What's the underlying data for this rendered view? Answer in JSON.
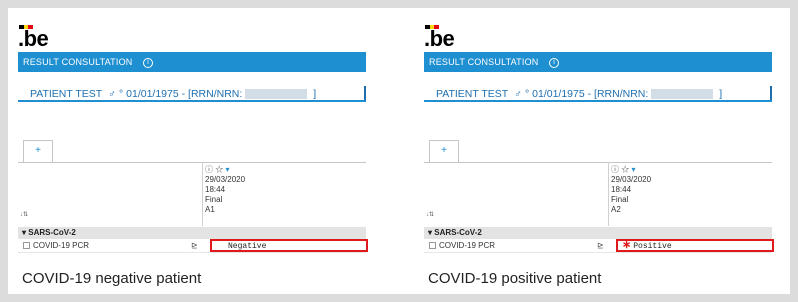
{
  "colors": {
    "header_blue": "#1e8fd0",
    "highlight_red": "#e0191c"
  },
  "panels": [
    {
      "logo": ".be",
      "header": "RESULT CONSULTATION",
      "header_icon": "info-icon",
      "patient": {
        "name": "PATIENT TEST",
        "sex": "♂",
        "dob": "° 01/01/1975 - [RRN/NRN:",
        "close": "]"
      },
      "tab": "+",
      "column": {
        "icons": "ⓘ ☆",
        "caret": "▾",
        "date": "29/03/2020",
        "time": "18:44",
        "status": "Final",
        "code": "A1"
      },
      "sort_label": "↓⇅",
      "section": "▾ SARS-CoV-2",
      "test": "COVID-19 PCR",
      "result": "Negative",
      "result_flag": "",
      "caption": "COVID-19 negative patient"
    },
    {
      "logo": ".be",
      "header": "RESULT CONSULTATION",
      "header_icon": "info-icon",
      "patient": {
        "name": "PATIENT TEST",
        "sex": "♂",
        "dob": "° 01/01/1975 - [RRN/NRN:",
        "close": "]"
      },
      "tab": "+",
      "column": {
        "icons": "ⓘ ☆",
        "caret": "▾",
        "date": "29/03/2020",
        "time": "18:44",
        "status": "Final",
        "code": "A2"
      },
      "sort_label": "↓⇅",
      "section": "▾ SARS-CoV-2",
      "test": "COVID-19 PCR",
      "result": "Positive",
      "result_flag": "∗",
      "caption": "COVID-19 positive patient"
    }
  ]
}
